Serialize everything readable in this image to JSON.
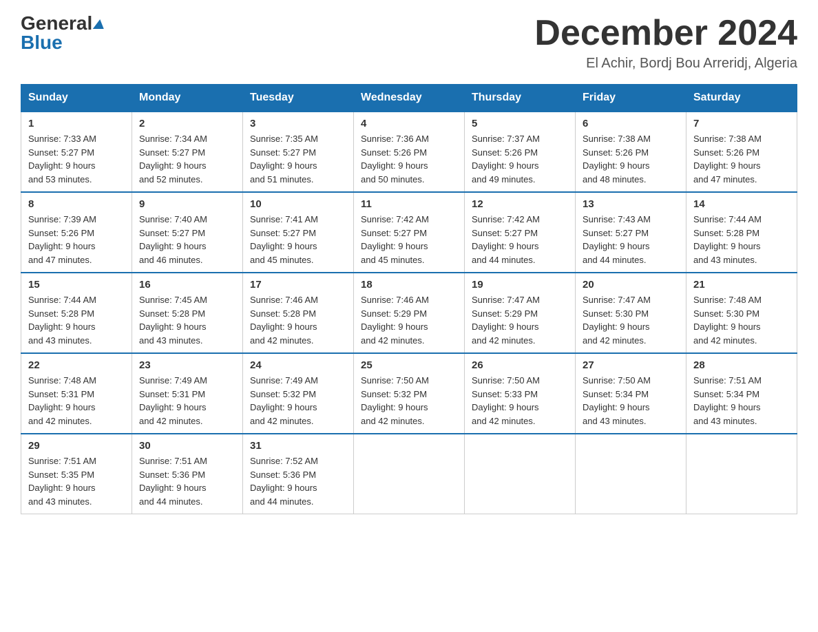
{
  "header": {
    "logo_general": "General",
    "logo_blue": "Blue",
    "month_title": "December 2024",
    "location": "El Achir, Bordj Bou Arreridj, Algeria"
  },
  "days_of_week": [
    "Sunday",
    "Monday",
    "Tuesday",
    "Wednesday",
    "Thursday",
    "Friday",
    "Saturday"
  ],
  "weeks": [
    [
      {
        "day": "1",
        "sunrise": "7:33 AM",
        "sunset": "5:27 PM",
        "daylight": "9 hours and 53 minutes."
      },
      {
        "day": "2",
        "sunrise": "7:34 AM",
        "sunset": "5:27 PM",
        "daylight": "9 hours and 52 minutes."
      },
      {
        "day": "3",
        "sunrise": "7:35 AM",
        "sunset": "5:27 PM",
        "daylight": "9 hours and 51 minutes."
      },
      {
        "day": "4",
        "sunrise": "7:36 AM",
        "sunset": "5:26 PM",
        "daylight": "9 hours and 50 minutes."
      },
      {
        "day": "5",
        "sunrise": "7:37 AM",
        "sunset": "5:26 PM",
        "daylight": "9 hours and 49 minutes."
      },
      {
        "day": "6",
        "sunrise": "7:38 AM",
        "sunset": "5:26 PM",
        "daylight": "9 hours and 48 minutes."
      },
      {
        "day": "7",
        "sunrise": "7:38 AM",
        "sunset": "5:26 PM",
        "daylight": "9 hours and 47 minutes."
      }
    ],
    [
      {
        "day": "8",
        "sunrise": "7:39 AM",
        "sunset": "5:26 PM",
        "daylight": "9 hours and 47 minutes."
      },
      {
        "day": "9",
        "sunrise": "7:40 AM",
        "sunset": "5:27 PM",
        "daylight": "9 hours and 46 minutes."
      },
      {
        "day": "10",
        "sunrise": "7:41 AM",
        "sunset": "5:27 PM",
        "daylight": "9 hours and 45 minutes."
      },
      {
        "day": "11",
        "sunrise": "7:42 AM",
        "sunset": "5:27 PM",
        "daylight": "9 hours and 45 minutes."
      },
      {
        "day": "12",
        "sunrise": "7:42 AM",
        "sunset": "5:27 PM",
        "daylight": "9 hours and 44 minutes."
      },
      {
        "day": "13",
        "sunrise": "7:43 AM",
        "sunset": "5:27 PM",
        "daylight": "9 hours and 44 minutes."
      },
      {
        "day": "14",
        "sunrise": "7:44 AM",
        "sunset": "5:28 PM",
        "daylight": "9 hours and 43 minutes."
      }
    ],
    [
      {
        "day": "15",
        "sunrise": "7:44 AM",
        "sunset": "5:28 PM",
        "daylight": "9 hours and 43 minutes."
      },
      {
        "day": "16",
        "sunrise": "7:45 AM",
        "sunset": "5:28 PM",
        "daylight": "9 hours and 43 minutes."
      },
      {
        "day": "17",
        "sunrise": "7:46 AM",
        "sunset": "5:28 PM",
        "daylight": "9 hours and 42 minutes."
      },
      {
        "day": "18",
        "sunrise": "7:46 AM",
        "sunset": "5:29 PM",
        "daylight": "9 hours and 42 minutes."
      },
      {
        "day": "19",
        "sunrise": "7:47 AM",
        "sunset": "5:29 PM",
        "daylight": "9 hours and 42 minutes."
      },
      {
        "day": "20",
        "sunrise": "7:47 AM",
        "sunset": "5:30 PM",
        "daylight": "9 hours and 42 minutes."
      },
      {
        "day": "21",
        "sunrise": "7:48 AM",
        "sunset": "5:30 PM",
        "daylight": "9 hours and 42 minutes."
      }
    ],
    [
      {
        "day": "22",
        "sunrise": "7:48 AM",
        "sunset": "5:31 PM",
        "daylight": "9 hours and 42 minutes."
      },
      {
        "day": "23",
        "sunrise": "7:49 AM",
        "sunset": "5:31 PM",
        "daylight": "9 hours and 42 minutes."
      },
      {
        "day": "24",
        "sunrise": "7:49 AM",
        "sunset": "5:32 PM",
        "daylight": "9 hours and 42 minutes."
      },
      {
        "day": "25",
        "sunrise": "7:50 AM",
        "sunset": "5:32 PM",
        "daylight": "9 hours and 42 minutes."
      },
      {
        "day": "26",
        "sunrise": "7:50 AM",
        "sunset": "5:33 PM",
        "daylight": "9 hours and 42 minutes."
      },
      {
        "day": "27",
        "sunrise": "7:50 AM",
        "sunset": "5:34 PM",
        "daylight": "9 hours and 43 minutes."
      },
      {
        "day": "28",
        "sunrise": "7:51 AM",
        "sunset": "5:34 PM",
        "daylight": "9 hours and 43 minutes."
      }
    ],
    [
      {
        "day": "29",
        "sunrise": "7:51 AM",
        "sunset": "5:35 PM",
        "daylight": "9 hours and 43 minutes."
      },
      {
        "day": "30",
        "sunrise": "7:51 AM",
        "sunset": "5:36 PM",
        "daylight": "9 hours and 44 minutes."
      },
      {
        "day": "31",
        "sunrise": "7:52 AM",
        "sunset": "5:36 PM",
        "daylight": "9 hours and 44 minutes."
      },
      null,
      null,
      null,
      null
    ]
  ]
}
